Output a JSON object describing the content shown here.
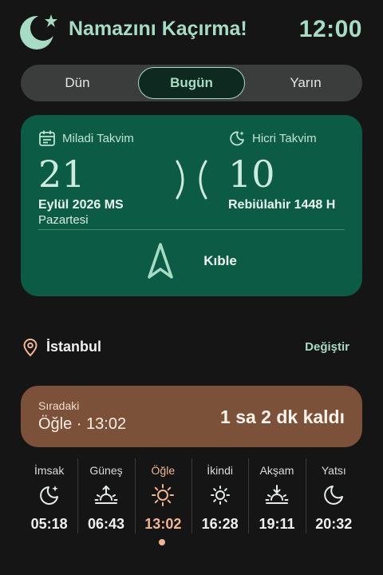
{
  "header": {
    "app_title": "Namazını Kaçırma!",
    "clock": "12:00",
    "accent_color": "#a6dcc3"
  },
  "day_tabs": [
    {
      "label": "Dün",
      "selected": false
    },
    {
      "label": "Bugün",
      "selected": true
    },
    {
      "label": "Yarın",
      "selected": false
    }
  ],
  "calendar": {
    "gregorian": {
      "label": "Miladi Takvim",
      "icon": "calendar-icon",
      "day": "21",
      "month_year": "Eylül 2026 MS",
      "weekday": "Pazartesi"
    },
    "hijri": {
      "label": "Hicri Takvim",
      "icon": "moon-star-icon",
      "day": "10",
      "month_year": "Rebiülahir 1448 H"
    },
    "card_color": "#0c5c45"
  },
  "qibla": {
    "label": "Kıble",
    "icon": "compass-arrow-icon"
  },
  "location": {
    "icon": "location-pin-icon",
    "city": "İstanbul",
    "change_label": "Değiştir"
  },
  "next_prayer": {
    "label": "Sıradaki",
    "prayer": "Öğle · 13:02",
    "remaining": "1 sa 2 dk kaldı",
    "card_color": "#7c5139"
  },
  "prayer_times": [
    {
      "name": "İmsak",
      "time": "05:18",
      "icon": "moon-star-icon",
      "active": false
    },
    {
      "name": "Güneş",
      "time": "06:43",
      "icon": "sunrise-icon",
      "active": false
    },
    {
      "name": "Öğle",
      "time": "13:02",
      "icon": "sun-icon",
      "active": true
    },
    {
      "name": "İkindi",
      "time": "16:28",
      "icon": "sun-small-icon",
      "active": false
    },
    {
      "name": "Akşam",
      "time": "19:11",
      "icon": "sunset-icon",
      "active": false
    },
    {
      "name": "Yatsı",
      "time": "20:32",
      "icon": "moon-icon",
      "active": false
    }
  ],
  "active_color": "#f0b591"
}
